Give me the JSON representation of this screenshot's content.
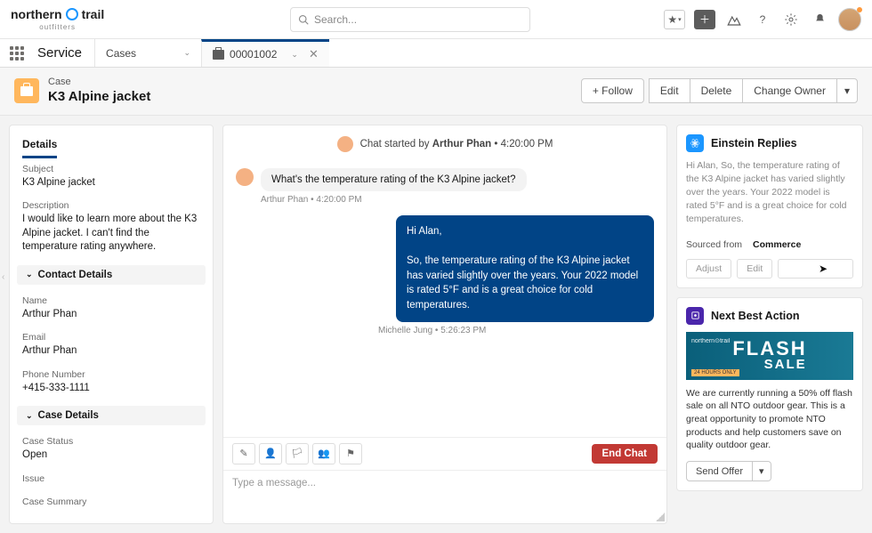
{
  "brand": {
    "name": "northern",
    "suffix": "trail",
    "sub": "outfitters"
  },
  "search": {
    "placeholder": "Search..."
  },
  "nav": {
    "app": "Service",
    "items": [
      {
        "label": "Cases"
      },
      {
        "label": "00001002",
        "active": true
      }
    ]
  },
  "header": {
    "eyebrow": "Case",
    "title": "K3 Alpine jacket",
    "actions": {
      "follow": "+  Follow",
      "edit": "Edit",
      "delete": "Delete",
      "change_owner": "Change Owner",
      "more": "▾"
    }
  },
  "details": {
    "tab": "Details",
    "subject_label": "Subject",
    "subject": "K3 Alpine jacket",
    "description_label": "Description",
    "description": "I would like to learn more about the K3 Alpine jacket. I can't find the temperature rating anywhere.",
    "contact_hdr": "Contact Details",
    "name_label": "Name",
    "name": "Arthur Phan",
    "email_label": "Email",
    "email": "Arthur Phan",
    "phone_label": "Phone Number",
    "phone": "+415-333-1111",
    "case_hdr": "Case Details",
    "status_label": "Case Status",
    "status": "Open",
    "issue_label": "Issue",
    "summary_label": "Case Summary"
  },
  "chat": {
    "start_prefix": "Chat started by ",
    "start_name": "Arthur Phan",
    "start_suffix": " • 4:20:00 PM",
    "msg1": "What's the temperature rating of the K3 Alpine jacket?",
    "msg1_meta": "Arthur Phan • 4:20:00 PM",
    "reply_greeting": "Hi Alan,",
    "reply_body": "So, the temperature rating of the K3 Alpine jacket has varied slightly over the years. Your 2022 model is rated 5°F and is a great choice for cold temperatures.",
    "reply_meta": "Michelle Jung • 5:26:23 PM",
    "end_chat": "End Chat",
    "compose_ph": "Type a message..."
  },
  "einstein": {
    "title": "Einstein Replies",
    "text": "Hi Alan, So, the temperature rating of the K3 Alpine jacket has varied slightly over the years. Your 2022 model is rated 5°F and is a great choice for cold temperatures.",
    "sourced_label": "Sourced from",
    "sourced_val": "Commerce",
    "adjust": "Adjust",
    "edit": "Edit"
  },
  "nba": {
    "title": "Next Best Action",
    "banner_line1": "FLASH",
    "banner_line2": "SALE",
    "banner_tag": "24 HOURS ONLY",
    "text": "We are currently running a 50% off flash sale on all NTO outdoor gear. This is a great opportunity to promote NTO products and help customers save on quality outdoor gear.",
    "send": "Send Offer",
    "chev": "▾"
  }
}
